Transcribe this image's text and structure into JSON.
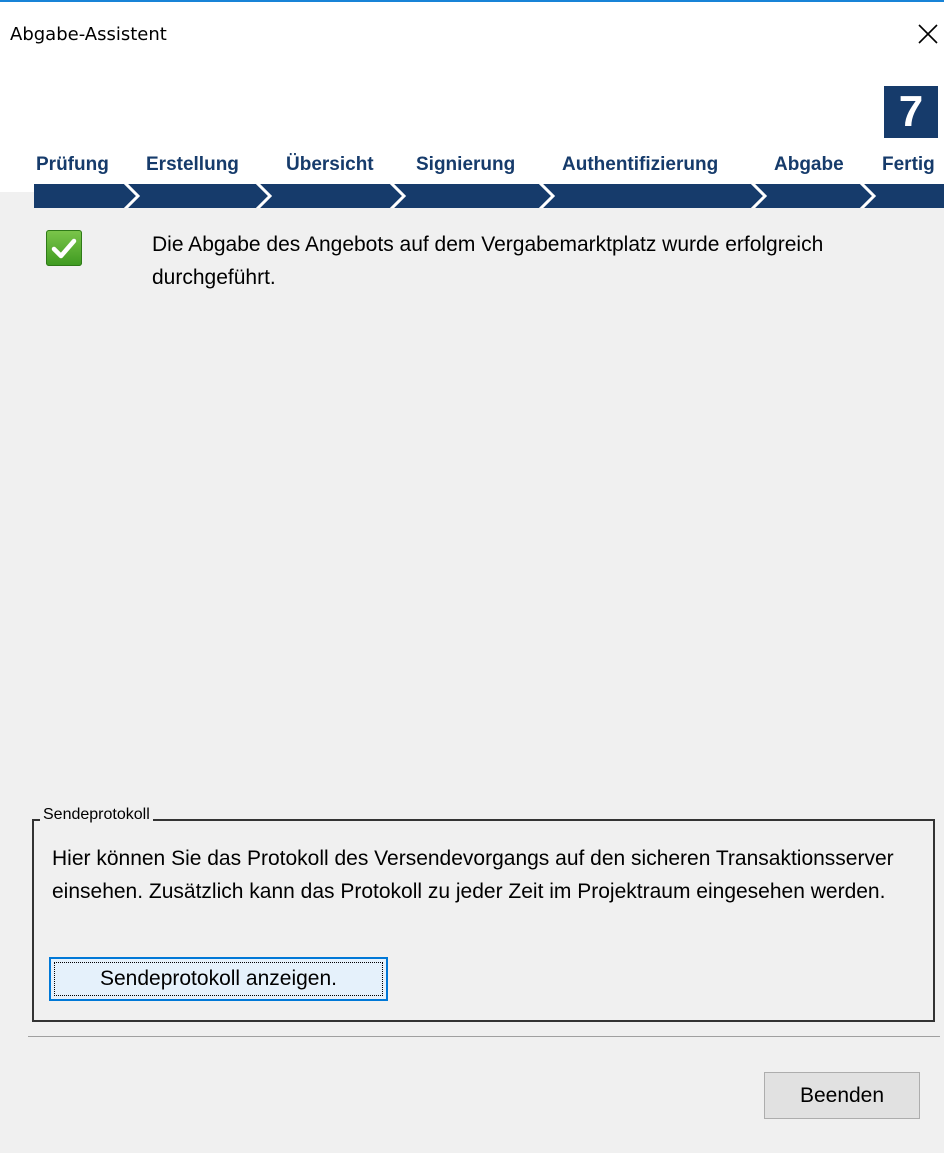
{
  "window": {
    "title": "Abgabe-Assistent",
    "close_icon": "close-icon"
  },
  "wizard": {
    "current_step": "7",
    "steps": [
      {
        "label": "Prüfung"
      },
      {
        "label": "Erstellung"
      },
      {
        "label": "Übersicht"
      },
      {
        "label": "Signierung"
      },
      {
        "label": "Authentifizierung"
      },
      {
        "label": "Abgabe"
      },
      {
        "label": "Fertig"
      }
    ],
    "accent_color": "#163b6b"
  },
  "status": {
    "icon": "checkmark-icon",
    "message": "Die Abgabe des Angebots auf dem Vergabemarktplatz wurde erfolgreich durchgeführt."
  },
  "protocol_group": {
    "legend": "Sendeprotokoll",
    "description": "Hier können Sie das Protokoll des Versendevorgangs auf den sicheren Transaktionsserver einsehen. Zusätzlich kann das Protokoll zu jeder Zeit im Projektraum eingesehen werden.",
    "button_label": "Sendeprotokoll anzeigen."
  },
  "footer": {
    "finish_label": "Beenden"
  }
}
